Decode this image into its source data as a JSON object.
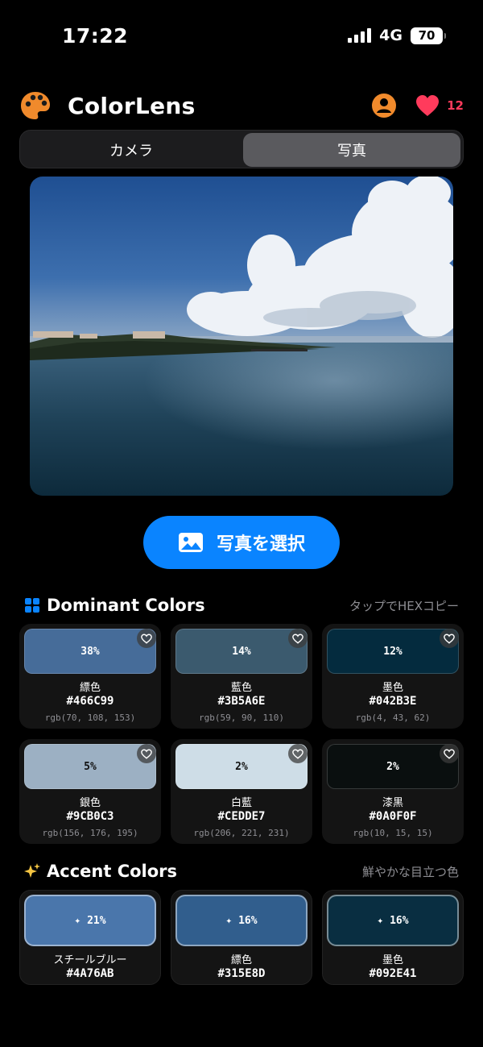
{
  "status": {
    "time": "17:22",
    "network": "4G",
    "battery": "70"
  },
  "header": {
    "title": "ColorLens",
    "favorites_count": "12"
  },
  "tabs": [
    {
      "label": "カメラ",
      "selected": false
    },
    {
      "label": "写真",
      "selected": true
    }
  ],
  "select_button": {
    "label": "写真を選択"
  },
  "dominant": {
    "title": "Dominant Colors",
    "hint": "タップでHEXコピー",
    "items": [
      {
        "pct": "38%",
        "name": "縹色",
        "hex": "#466C99",
        "rgb": "rgb(70, 108, 153)",
        "color": "#466C99",
        "text": "#ffffff"
      },
      {
        "pct": "14%",
        "name": "藍色",
        "hex": "#3B5A6E",
        "rgb": "rgb(59, 90, 110)",
        "color": "#3B5A6E",
        "text": "#ffffff"
      },
      {
        "pct": "12%",
        "name": "墨色",
        "hex": "#042B3E",
        "rgb": "rgb(4, 43, 62)",
        "color": "#042B3E",
        "text": "#ffffff"
      },
      {
        "pct": "5%",
        "name": "銀色",
        "hex": "#9CB0C3",
        "rgb": "rgb(156, 176, 195)",
        "color": "#9CB0C3",
        "text": "#111111"
      },
      {
        "pct": "2%",
        "name": "白藍",
        "hex": "#CEDDE7",
        "rgb": "rgb(206, 221, 231)",
        "color": "#CEDDE7",
        "text": "#111111"
      },
      {
        "pct": "2%",
        "name": "漆黒",
        "hex": "#0A0F0F",
        "rgb": "rgb(10, 15, 15)",
        "color": "#0A0F0F",
        "text": "#ffffff"
      }
    ]
  },
  "accent": {
    "title": "Accent Colors",
    "hint": "鮮やかな目立つ色",
    "items": [
      {
        "pct": "✦ 21%",
        "name": "スチールブルー",
        "hex": "#4A76AB",
        "color": "#4A76AB"
      },
      {
        "pct": "✦ 16%",
        "name": "縹色",
        "hex": "#315E8D",
        "color": "#315E8D"
      },
      {
        "pct": "✦ 16%",
        "name": "墨色",
        "hex": "#092E41",
        "color": "#092E41"
      }
    ]
  }
}
